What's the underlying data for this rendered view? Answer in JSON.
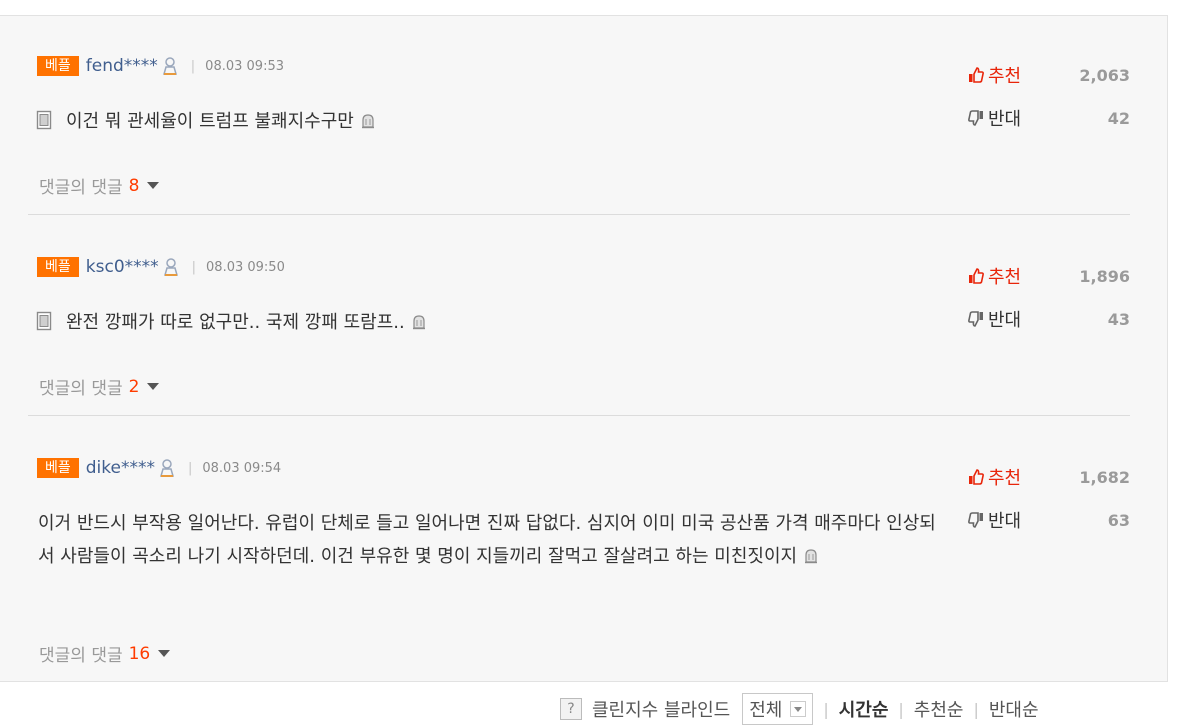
{
  "comments": [
    {
      "badge": "베플",
      "nick": "fend****",
      "time": "08.03 09:53",
      "text": "이건 뭐 관세율이 트럼프 불쾌지수구만",
      "has_doc_icon": true,
      "replies_label": "댓글의 댓글",
      "replies_count": "8",
      "up_label": "추천",
      "up_count": "2,063",
      "down_label": "반대",
      "down_count": "42"
    },
    {
      "badge": "베플",
      "nick": "ksc0****",
      "time": "08.03 09:50",
      "text": "완전 깡패가 따로 없구만.. 국제 깡패 또람프..",
      "has_doc_icon": true,
      "replies_label": "댓글의 댓글",
      "replies_count": "2",
      "up_label": "추천",
      "up_count": "1,896",
      "down_label": "반대",
      "down_count": "43"
    },
    {
      "badge": "베플",
      "nick": "dike****",
      "time": "08.03 09:54",
      "text": "이거 반드시 부작용 일어난다. 유럽이 단체로 들고 일어나면 진짜 답없다. 심지어 이미 미국 공산품 가격 매주마다 인상되서 사람들이 곡소리 나기 시작하던데. 이건 부유한 몇 명이 지들끼리 잘먹고 잘살려고 하는 미친짓이지",
      "has_doc_icon": false,
      "replies_label": "댓글의 댓글",
      "replies_count": "16",
      "up_label": "추천",
      "up_count": "1,682",
      "down_label": "반대",
      "down_count": "63"
    }
  ],
  "footer": {
    "clean_label": "클린지수 블라인드",
    "select_value": "전체",
    "sort_time": "시간순",
    "sort_up": "추천순",
    "sort_down": "반대순"
  },
  "colors": {
    "badge": "#ff7200",
    "nick": "#405e8e",
    "up": "#e8250a",
    "reply_count": "#ff3c00"
  }
}
